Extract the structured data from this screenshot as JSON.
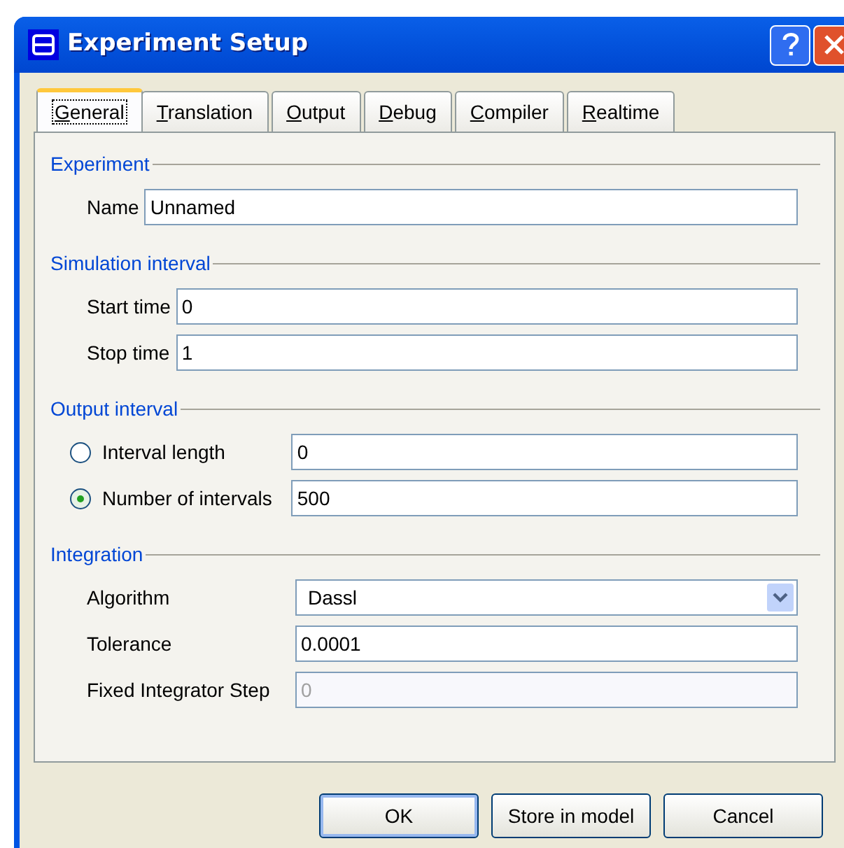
{
  "window": {
    "title": "Experiment Setup"
  },
  "tabs": [
    {
      "label": "General",
      "selected": true
    },
    {
      "label": "Translation",
      "selected": false
    },
    {
      "label": "Output",
      "selected": false
    },
    {
      "label": "Debug",
      "selected": false
    },
    {
      "label": "Compiler",
      "selected": false
    },
    {
      "label": "Realtime",
      "selected": false
    }
  ],
  "groups": [
    {
      "title": "Experiment",
      "rows": [
        {
          "kind": "text",
          "label": "Name",
          "value": "Unnamed"
        }
      ]
    },
    {
      "title": "Simulation interval",
      "rows": [
        {
          "kind": "text",
          "label": "Start time",
          "value": "0"
        },
        {
          "kind": "text",
          "label": "Stop time",
          "value": "1"
        }
      ]
    },
    {
      "title": "Output interval",
      "rows": [
        {
          "kind": "radio",
          "label": "Interval length",
          "value": "0",
          "selected": false
        },
        {
          "kind": "radio",
          "label": "Number of intervals",
          "value": "500",
          "selected": true
        }
      ]
    },
    {
      "title": "Integration",
      "rows": [
        {
          "kind": "select",
          "label": "Algorithm",
          "value": "Dassl"
        },
        {
          "kind": "text",
          "label": "Tolerance",
          "value": "0.0001"
        },
        {
          "kind": "text",
          "label": "Fixed Integrator Step",
          "value": "0",
          "disabled": true
        }
      ]
    }
  ],
  "buttons": [
    {
      "label": "OK",
      "default": true
    },
    {
      "label": "Store in model",
      "default": false
    },
    {
      "label": "Cancel",
      "default": false
    }
  ]
}
